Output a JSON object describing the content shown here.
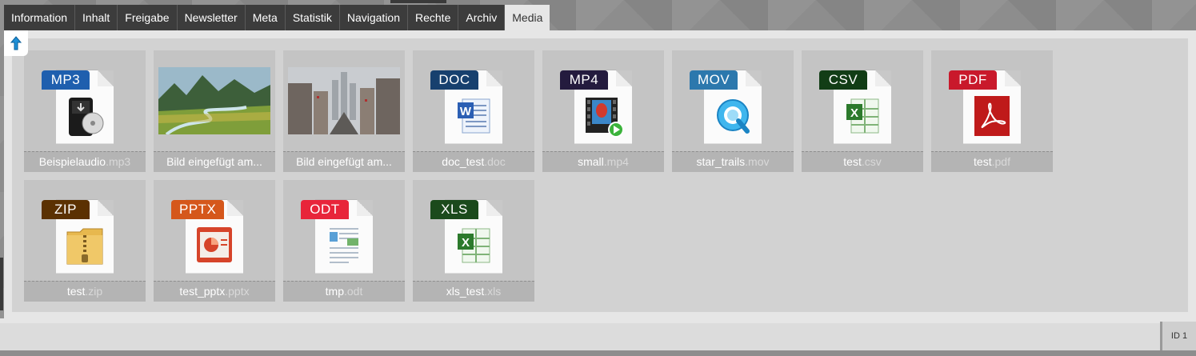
{
  "tabs": [
    "Information",
    "Inhalt",
    "Freigabe",
    "Newsletter",
    "Meta",
    "Statistik",
    "Navigation",
    "Rechte",
    "Archiv",
    "Media"
  ],
  "active_tab": "Media",
  "back_button": {
    "icon": "arrow-up-icon"
  },
  "files": [
    {
      "name": "Beispielaudio",
      "ext": ".mp3",
      "badge": "MP3",
      "badge_color": "#1f5fae",
      "kind": "audio"
    },
    {
      "name": "Bild eingefügt am...",
      "ext": "",
      "kind": "photo-landscape"
    },
    {
      "name": "Bild eingefügt am...",
      "ext": "",
      "kind": "photo-city"
    },
    {
      "name": "doc_test",
      "ext": ".doc",
      "badge": "DOC",
      "badge_color": "#17406e",
      "kind": "word"
    },
    {
      "name": "small",
      "ext": ".mp4",
      "badge": "MP4",
      "badge_color": "#241b3e",
      "kind": "video"
    },
    {
      "name": "star_trails",
      "ext": ".mov",
      "badge": "MOV",
      "badge_color": "#2c78ad",
      "kind": "quicktime"
    },
    {
      "name": "test",
      "ext": ".csv",
      "badge": "CSV",
      "badge_color": "#123d16",
      "kind": "excel"
    },
    {
      "name": "test",
      "ext": ".pdf",
      "badge": "PDF",
      "badge_color": "#c9192b",
      "kind": "pdf"
    },
    {
      "name": "test",
      "ext": ".zip",
      "badge": "ZIP",
      "badge_color": "#5b3102",
      "kind": "zip"
    },
    {
      "name": "test_pptx",
      "ext": ".pptx",
      "badge": "PPTX",
      "badge_color": "#d5571b",
      "kind": "powerpoint"
    },
    {
      "name": "tmp",
      "ext": ".odt",
      "badge": "ODT",
      "badge_color": "#e8253a",
      "kind": "odt"
    },
    {
      "name": "xls_test",
      "ext": ".xls",
      "badge": "XLS",
      "badge_color": "#1b4a1c",
      "kind": "excel"
    }
  ],
  "status": {
    "id_label": "ID 1"
  }
}
